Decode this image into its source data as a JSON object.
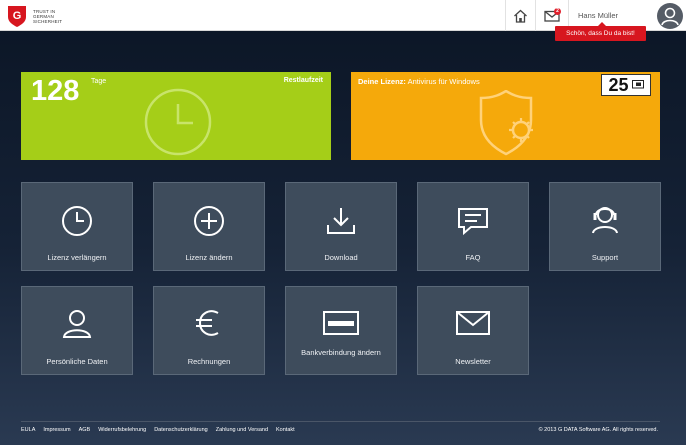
{
  "header": {
    "logo_text": "Trust in German Sicherheit",
    "user_name": "Hans Müller",
    "mail_badge": "2",
    "tooltip": "Schön, dass Du da bist!"
  },
  "banners": {
    "days_value": "128",
    "days_unit": "Tage",
    "remaining_label": "Restlaufzeit",
    "license_prefix": "Deine Lizenz:",
    "license_product": "Antivirus für Windows",
    "license_count": "25"
  },
  "tiles": [
    {
      "label": "Lizenz verlängern",
      "icon": "clock-icon"
    },
    {
      "label": "Lizenz ändern",
      "icon": "plus-circle-icon"
    },
    {
      "label": "Download",
      "icon": "download-icon"
    },
    {
      "label": "FAQ",
      "icon": "chat-bubble-icon"
    },
    {
      "label": "Support",
      "icon": "headset-icon"
    },
    {
      "label": "Persönliche Daten",
      "icon": "user-icon"
    },
    {
      "label": "Rechnungen",
      "icon": "euro-icon"
    },
    {
      "label": "Bankverbindung ändern",
      "icon": "card-icon"
    },
    {
      "label": "Newsletter",
      "icon": "envelope-icon"
    }
  ],
  "footer": {
    "links": [
      "EULA",
      "Impressum",
      "AGB",
      "Widerrufsbelehrung",
      "Datenschutzerklärung",
      "Zahlung und Versand",
      "Kontakt"
    ],
    "copyright": "© 2013 G DATA Software AG. All rights reserved."
  },
  "colors": {
    "green": "#a5ce18",
    "orange": "#f5a90b",
    "tile": "#3e4c5c",
    "brand_red": "#d7161f"
  }
}
